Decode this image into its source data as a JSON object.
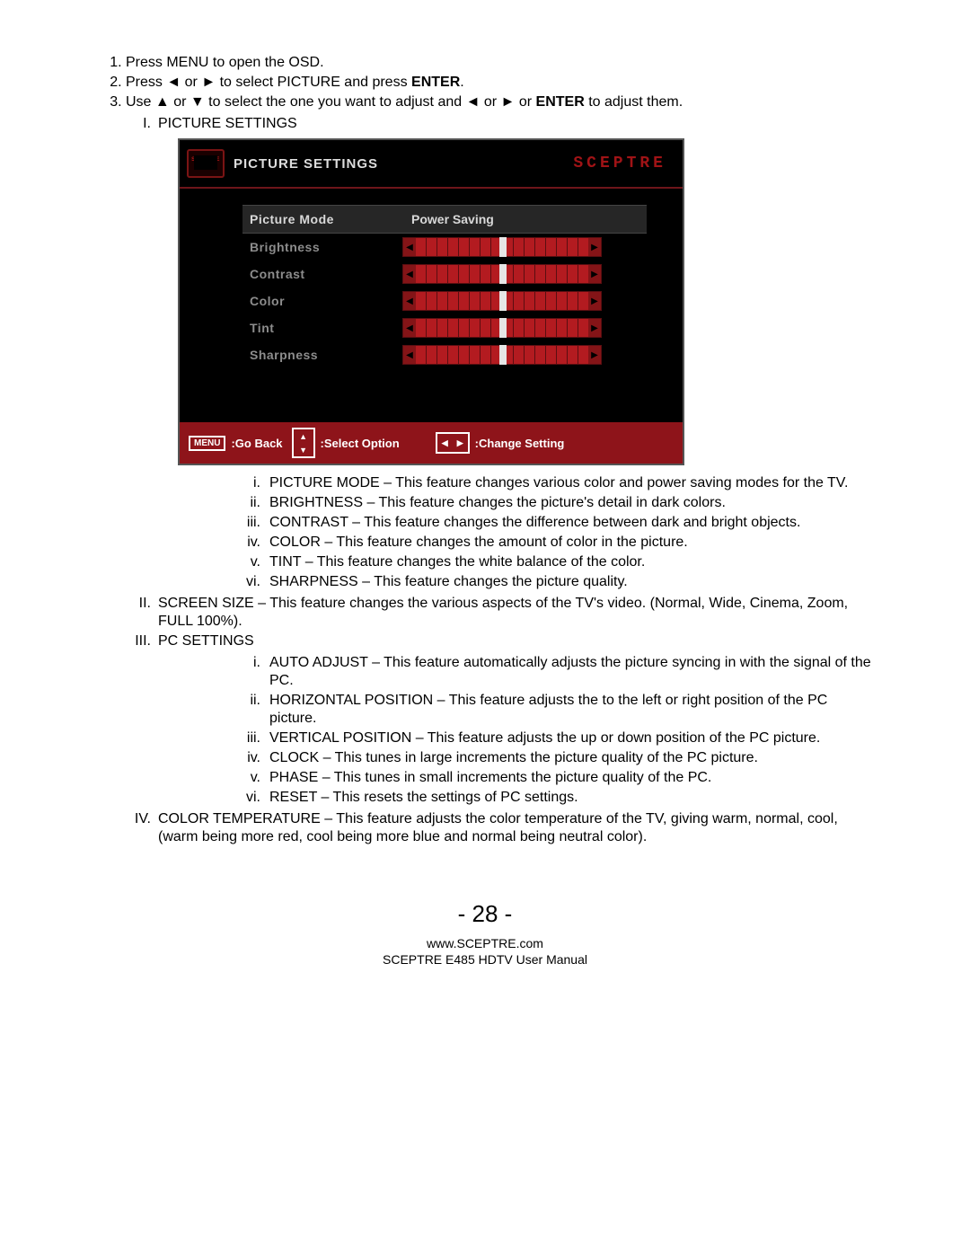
{
  "steps": {
    "s1": "Press MENU to open the OSD.",
    "s2_pre": "Press ",
    "s2_left": "◄",
    "s2_mid": " or ",
    "s2_right": "►",
    "s2_post": " to select PICTURE and press ",
    "s2_enter": "ENTER",
    "s2_end": ".",
    "s3_pre": "Use ",
    "s3_up": "▲",
    "s3_or1": " or ",
    "s3_down": "▼",
    "s3_mid": " to select the one you want to adjust and ",
    "s3_left": "◄",
    "s3_or2": " or ",
    "s3_right": "►",
    "s3_or3": " or ",
    "s3_enter": "ENTER",
    "s3_post": " to adjust them."
  },
  "osd": {
    "title": "PICTURE SETTINGS",
    "brand": "SCEPTRE",
    "brand_small": "SCEPTRE",
    "rows": {
      "r0_label": "Picture Mode",
      "r0_value": "Power Saving",
      "r1_label": "Brightness",
      "r2_label": "Contrast",
      "r3_label": "Color",
      "r4_label": "Tint",
      "r5_label": "Sharpness"
    },
    "footer": {
      "menu": "MENU",
      "back": ":Go Back",
      "select": ":Select Option",
      "change": ":Change Setting"
    }
  },
  "sections": {
    "I_label": "I.",
    "I_title": "PICTURE SETTINGS",
    "I_i": "PICTURE MODE – This feature changes various color and power saving modes for the TV.",
    "I_ii": "BRIGHTNESS – This feature changes the picture's detail in dark colors.",
    "I_iii": "CONTRAST – This feature changes the difference between dark and bright objects.",
    "I_iv": "COLOR – This feature changes the amount of color in the picture.",
    "I_v": "TINT – This feature changes the white balance of the color.",
    "I_vi": "SHARPNESS – This feature changes the picture quality.",
    "II_label": "II.",
    "II_text": "SCREEN SIZE – This feature changes the various aspects of the TV's video.  (Normal, Wide, Cinema, Zoom, FULL 100%).",
    "III_label": "III.",
    "III_title": "PC SETTINGS",
    "III_i": "AUTO ADJUST – This feature automatically adjusts the picture syncing in with the signal of the PC.",
    "III_ii": "HORIZONTAL POSITION – This feature adjusts the to the left or right position of the PC picture.",
    "III_iii": "VERTICAL POSITION – This feature adjusts the up or down position of the PC picture.",
    "III_iv": "CLOCK – This tunes in large increments the picture quality of the PC picture.",
    "III_v": "PHASE – This tunes in small increments the picture quality of the PC.",
    "III_vi": "RESET – This resets the settings of PC settings.",
    "IV_label": "IV.",
    "IV_text": "COLOR TEMPERATURE – This feature adjusts the color temperature of the TV, giving warm, normal, cool, (warm being more red, cool being more blue and normal being neutral color)."
  },
  "page_number": "- 28 -",
  "footer_url": "www.SCEPTRE.com",
  "footer_manual": "SCEPTRE E485 HDTV User Manual"
}
